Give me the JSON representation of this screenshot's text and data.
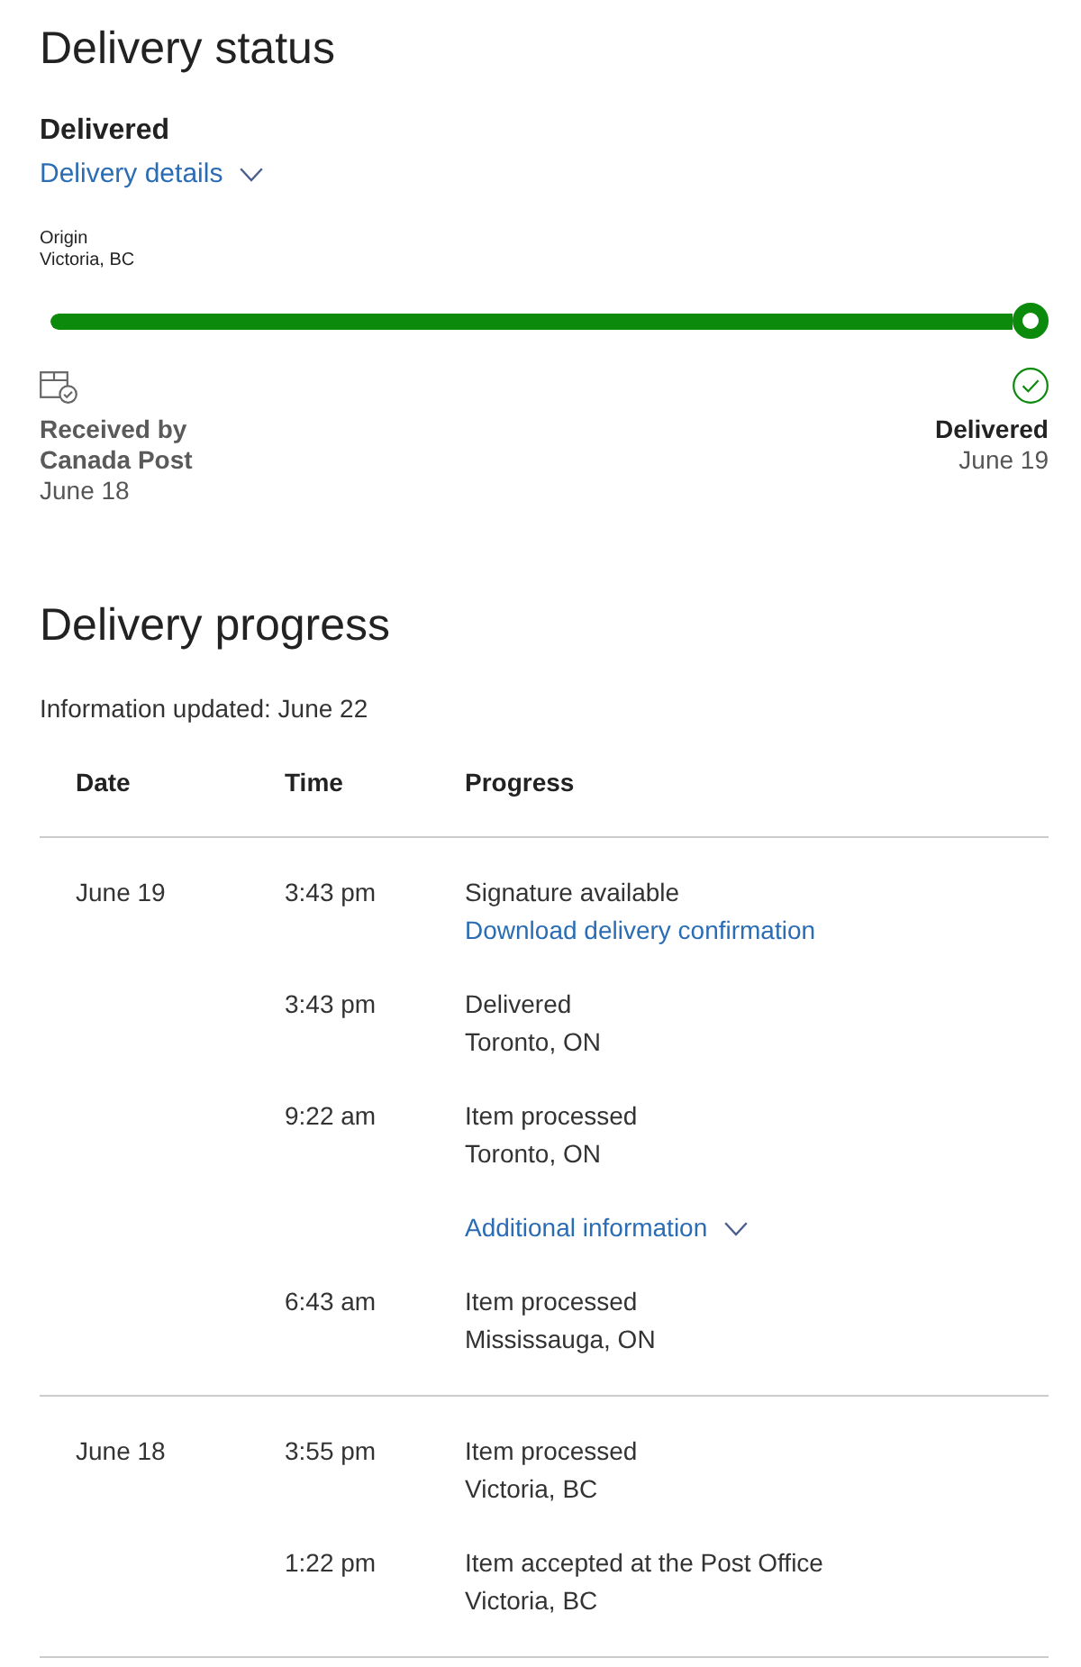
{
  "status": {
    "title": "Delivery status",
    "state": "Delivered",
    "details_toggle": {
      "label": "Delivery details",
      "expanded": false
    }
  },
  "origin": {
    "label": "Origin",
    "place": "Victoria, BC"
  },
  "tracker": {
    "level": 1,
    "steps": [
      {
        "kind": "received",
        "title": "Received by Canada Post",
        "date": "June 18",
        "current": false
      },
      {
        "kind": "delivered",
        "title": "Delivered",
        "date": "June 19",
        "current": true
      }
    ]
  },
  "progress": {
    "title": "Delivery progress",
    "updated": "Information updated: June 22",
    "columns": [
      "Date",
      "Time",
      "Progress"
    ],
    "groups": [
      {
        "date": "June 19",
        "events": [
          {
            "kind": "event",
            "time": "3:43 pm",
            "description": "Signature available",
            "link": "Download delivery confirmation"
          },
          {
            "kind": "event",
            "time": "3:43 pm",
            "description": "Delivered",
            "location": "Toronto, ON"
          },
          {
            "kind": "event",
            "time": "9:22 am",
            "description": "Item processed",
            "location": "Toronto, ON"
          },
          {
            "kind": "expander",
            "label": "Additional information",
            "expanded": false
          },
          {
            "kind": "event",
            "time": "6:43 am",
            "description": "Item processed",
            "location": "Mississauga, ON"
          }
        ]
      },
      {
        "date": "June 18",
        "events": [
          {
            "kind": "event",
            "time": "3:55 pm",
            "description": "Item processed",
            "location": "Victoria, BC"
          },
          {
            "kind": "event",
            "time": "1:22 pm",
            "description": "Item accepted at the Post Office",
            "location": "Victoria, BC"
          }
        ]
      }
    ]
  }
}
